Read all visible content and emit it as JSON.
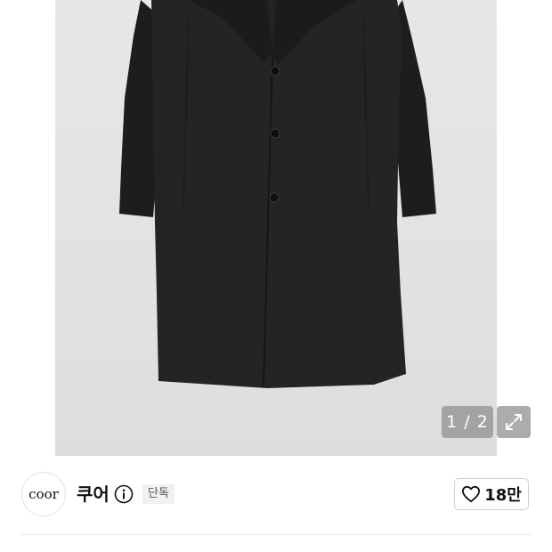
{
  "gallery": {
    "image_subject": "black wool long coat",
    "counter": "1 / 2",
    "current_index": 1,
    "total": 2,
    "expand_icon": "expand-arrows-icon"
  },
  "shop": {
    "logo_text": "coor",
    "name": "쿠어",
    "info_icon": "info-circle-icon",
    "badge": "단독"
  },
  "like": {
    "icon": "heart-outline-icon",
    "count": "18만"
  },
  "colors": {
    "photo_background": "#e2e3e5",
    "coat": "#202122",
    "overlay": "#8c8c8c",
    "border": "#cfcfcf"
  }
}
